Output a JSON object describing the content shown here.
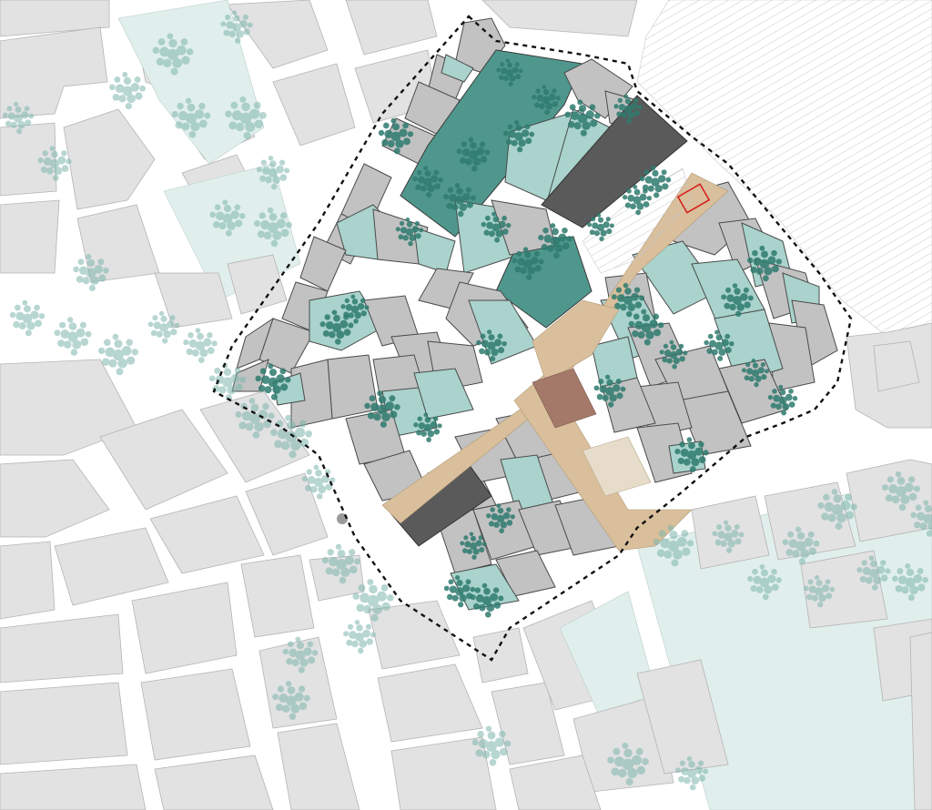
{
  "map": {
    "layers": [
      "context-buildings",
      "context-green",
      "project-area",
      "street-trees",
      "study-boundary"
    ],
    "colors": {
      "building": "#c2c2c2",
      "context_building": "#e2e2e2",
      "courtyard": "#a9d3cc",
      "courtyard_dark": "#4f978c",
      "dark_building": "#5a5a5a",
      "street_paving": "#d9bf9b",
      "plaza": "#e6dcc9",
      "plaza_highlight": "#a4796a",
      "boundary": "#111111",
      "marker": "#d62020",
      "tree": "#2f7b6f"
    },
    "icons": [
      "tree-icon",
      "round-marker-icon",
      "red-outline-marker-icon"
    ]
  }
}
